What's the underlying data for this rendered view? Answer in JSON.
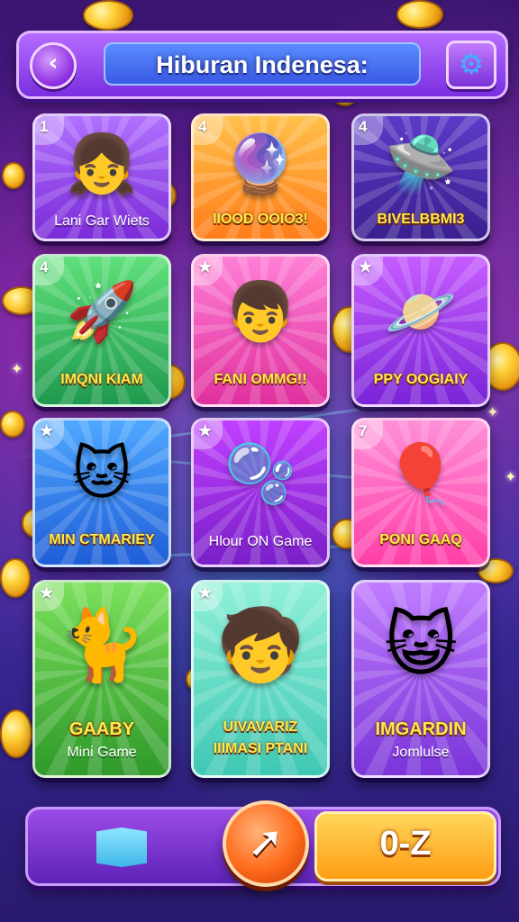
{
  "header": {
    "title": "Hiburan Indenesa:",
    "back_icon": "chevron-left-icon",
    "settings_icon": "gear-icon"
  },
  "cards": [
    {
      "badge": "1",
      "art": "girl-character",
      "label": "Lani Gar Wiets",
      "sub": ""
    },
    {
      "badge": "4",
      "art": "crystal-ball",
      "label": "IIOOD OOIO3!",
      "sub": ""
    },
    {
      "badge": "4",
      "art": "green-spaceship",
      "label": "BIVELBBMI3",
      "sub": ""
    },
    {
      "badge": "4",
      "art": "rocket",
      "label": "IMQNI KIAM",
      "sub": ""
    },
    {
      "badge": "★",
      "art": "boy-with-coins",
      "label": "FANI OMMG!!",
      "sub": ""
    },
    {
      "badge": "★",
      "art": "ufo-planet",
      "label": "PPY OOGIAIY",
      "sub": ""
    },
    {
      "badge": "★",
      "art": "winking-cat",
      "label": "MIN CTMARIEY",
      "sub": ""
    },
    {
      "badge": "★",
      "art": "magic-bubble",
      "label": "Hlour ON Game",
      "sub": ""
    },
    {
      "badge": "7",
      "art": "balloon",
      "label": "PONI GAAQ",
      "sub": ""
    },
    {
      "badge": "★",
      "art": "cat-with-magic",
      "label": "GAABY",
      "sub": "Mini Game"
    },
    {
      "badge": "★",
      "art": "boy-with-hat",
      "label": "UIVAVARIZ",
      "sub": "IIIMASI PTANI"
    },
    {
      "badge": "",
      "art": "purple-cat",
      "label": "IMGARDIN",
      "sub": "Jomlulse"
    }
  ],
  "bottom_bar": {
    "map_icon": "map-icon",
    "pointer_icon": "cursor-pointer-icon",
    "sort_label": "0-Z"
  },
  "colors": {
    "header": "#8a3ae6",
    "sort_button": "#ffa81e",
    "pointer_button": "#ff6a1a"
  }
}
